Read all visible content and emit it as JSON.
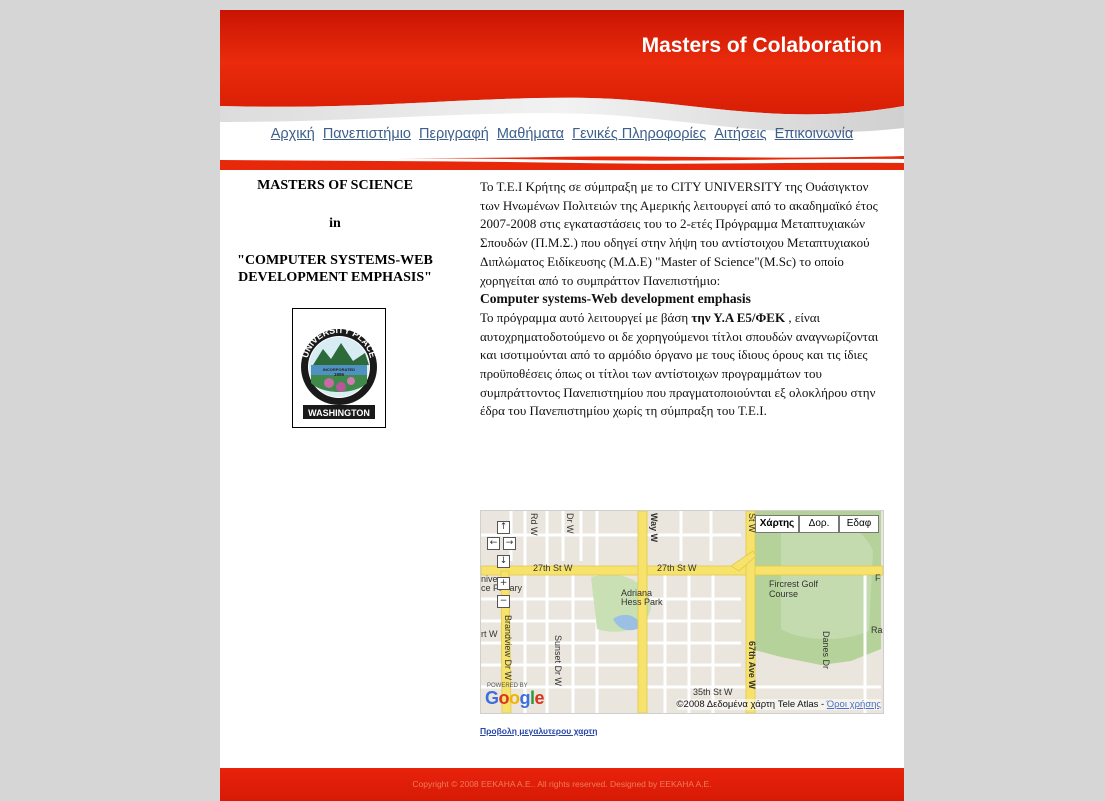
{
  "header": {
    "site_title": "Masters of Colaboration"
  },
  "nav": {
    "items": [
      {
        "label": "Αρχική"
      },
      {
        "label": "Πανεπιστήμιο"
      },
      {
        "label": "Περιγραφή"
      },
      {
        "label": "Μαθήματα"
      },
      {
        "label": "Γενικές Πληροφορίες"
      },
      {
        "label": "Αιτήσεις"
      },
      {
        "label": "Επικοινωνία"
      }
    ]
  },
  "left": {
    "line1": "MASTERS OF SCIENCE",
    "line2": "in",
    "line3": "\"COMPUTER SYSTEMS-WEB DEVELOPMENT EMPHASIS\"",
    "logo": {
      "top_text": "UNIVERSITY PLACE",
      "mid_text": "INCORPORATED\n1995",
      "bottom_text": "WASHINGTON"
    }
  },
  "content": {
    "para1": "Το Τ.Ε.Ι Κρήτης σε σύμπραξη με το CITY UNIVERSITY της Ουάσιγκτον των Ηνωμένων Πολιτειών της Αμερικής λειτουργεί από το ακαδημαϊκό έτος 2007-2008 στις εγκαταστάσεις του το 2-ετές Πρόγραμμα Μεταπτυχιακών Σπουδών (Π.Μ.Σ.) που οδηγεί στην λήψη του αντίστοιχου Μεταπτυχιακού Διπλώματος Ειδίκευσης (Μ.Δ.Ε) \"Master of Science\"(M.Sc) το οποίο χορηγείται από το συμπράττον Πανεπιστήμιο:",
    "program_title": "Computer systems-Web development emphasis",
    "para2_start": "Το πρόγραμμα αυτό λειτουργεί με βάση ",
    "para2_bold": "την Υ.Α Ε5/ΦΕΚ",
    "para2_end": " , είναι αυτοχρηματοδοτούμενο οι δε χορηγούμενοι τίτλοι σπουδών αναγνωρίζονται και ισοτιμούνται από το αρμόδιο όργανο με τους ίδιους όρους και τις ίδιες προϋποθέσεις όπως οι τίτλοι των αντίστοιχων προγραμμάτων του συμπράττοντος Πανεπιστημίου που πραγματοποιούνται εξ ολοκλήρου στην έδρα του Πανεπιστημίου χωρίς τη σύμπραξη του Τ.Ε.Ι."
  },
  "map": {
    "types": [
      "Χάρτης",
      "Δορ.",
      "Εδαφ"
    ],
    "labels": {
      "st27_a": "27th St W",
      "st27_b": "27th St W",
      "st35": "35th St W",
      "ave67": "67th Ave W",
      "way": "Way W",
      "brandview": "Brandview Dr W",
      "sunset": "Sunset Dr W",
      "adriana": "Adriana Hess Park",
      "fircrest": "Fircrest Golf Course",
      "danes": "Danes Dr",
      "rd": "Rd W",
      "dr": "Dr W",
      "sw": "St W",
      "ra": "Ra",
      "f": "F",
      "rtw": "rt W",
      "elem": "nive\nce Pr   ary"
    },
    "powered": "POWERED BY",
    "google": "Google",
    "copyright": "©2008 Δεδομένα χάρτη Tele Atlas - ",
    "terms": "Όροι χρήσης"
  },
  "bigmap_link": "Προβολη μεγαλυτερου χαρτη",
  "footer": {
    "text": "Copyright © 2008 EEKAHA A.E.. All rights reserved. Designed by EEKAHA A.E."
  },
  "colors": {
    "brand_red": "#e01c06",
    "background": "#d6d6d6",
    "nav_link": "#3d5f8c"
  }
}
